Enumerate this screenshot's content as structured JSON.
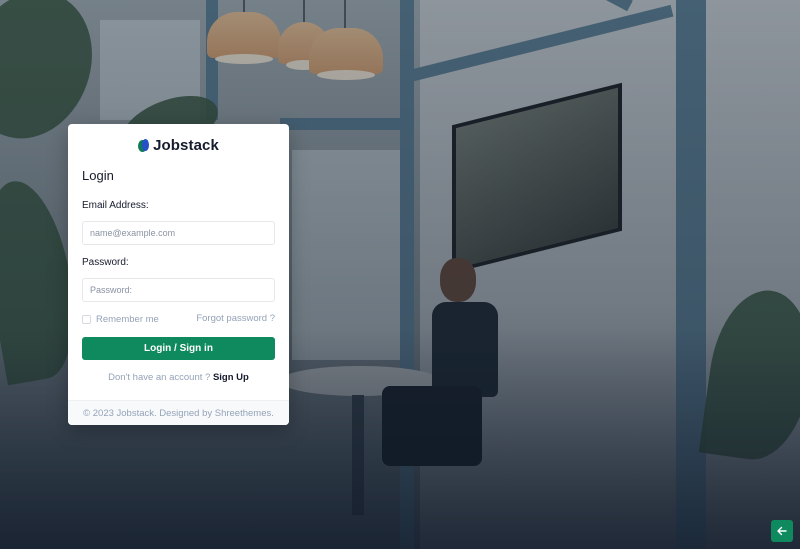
{
  "brand": {
    "name": "Jobstack"
  },
  "login": {
    "title": "Login",
    "email_label": "Email Address:",
    "email_placeholder": "name@example.com",
    "email_value": "",
    "password_label": "Password:",
    "password_placeholder": "Password:",
    "password_value": "",
    "remember_label": "Remember me",
    "remember_checked": false,
    "forgot_label": "Forgot password ?",
    "submit_label": "Login / Sign in",
    "no_account_text": "Don't have an account ?",
    "signup_label": "Sign Up"
  },
  "footer": {
    "copyright": "© 2023 Jobstack. Designed by Shreethemes."
  },
  "colors": {
    "accent": "#0f8a5f",
    "heading": "#161c2d",
    "muted": "#94a3b8"
  },
  "icons": {
    "back": "arrow-left-icon",
    "logo": "jobstack-logo-icon"
  }
}
